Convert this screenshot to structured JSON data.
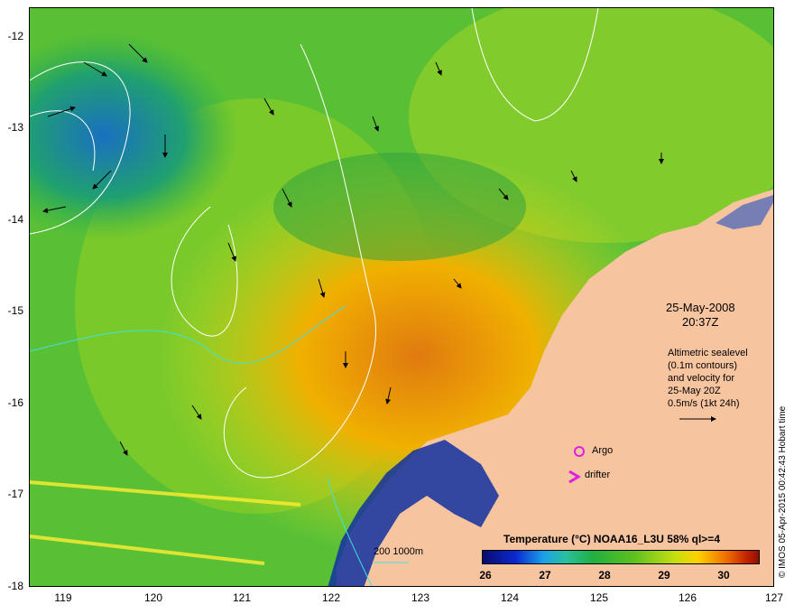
{
  "map": {
    "lat_labels": [
      "-12",
      "-13",
      "-14",
      "-15",
      "-16",
      "-17",
      "-18"
    ],
    "lon_labels": [
      "119",
      "120",
      "121",
      "122",
      "123",
      "124",
      "125",
      "126",
      "127"
    ],
    "timestamp_date": "25-May-2008",
    "timestamp_time": "20:37Z",
    "legend_lines": [
      "Altimetric sealevel",
      "(0.1m contours)",
      "and velocity for",
      "25-May 20Z",
      "0.5m/s (1kt 24h)"
    ],
    "argo_label": "Argo",
    "drifter_label": "drifter",
    "depth_label": "200  1000m",
    "colorbar_title": "Temperature (°C) NOAA16_L3U 58% ql>=4",
    "colorbar_ticks": [
      "26",
      "27",
      "28",
      "29",
      "30"
    ],
    "credit": "© IMOS 05-Apr-2015 00:42:43 Hobart time",
    "colors": {
      "land": "#f7c4a0",
      "argo": "#e020e0",
      "drifter": "#e020e0",
      "isobath": "#40e0e0"
    }
  }
}
